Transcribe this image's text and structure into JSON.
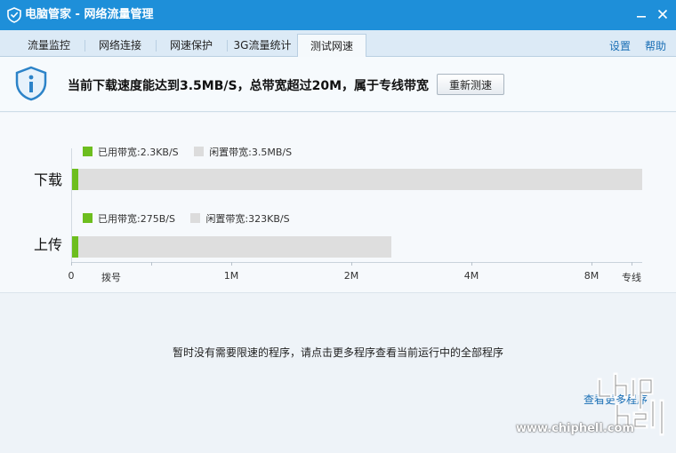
{
  "window": {
    "title": "电脑管家 - 网络流量管理",
    "logo_icon": "shield-logo-icon",
    "minimize_icon": "minimize-icon",
    "close_icon": "close-icon"
  },
  "tabs": [
    {
      "label": "流量监控",
      "active": false
    },
    {
      "label": "网络连接",
      "active": false
    },
    {
      "label": "网速保护",
      "active": false
    },
    {
      "label": "3G流量统计",
      "active": false
    },
    {
      "label": "测试网速",
      "active": true
    }
  ],
  "top_links": {
    "settings": "设置",
    "help": "帮助"
  },
  "banner": {
    "icon": "info-shield-icon",
    "message": "当前下载速度能达到3.5MB/S，总带宽超过20M，属于专线带宽",
    "retest_label": "重新测速"
  },
  "chart_data": {
    "type": "bar",
    "orientation": "horizontal",
    "categories": [
      "下载",
      "上传"
    ],
    "series": [
      {
        "name": "已用带宽",
        "values_text": [
          "2.3KB/S",
          "275B/S"
        ]
      },
      {
        "name": "闲置带宽",
        "values_text": [
          "3.5MB/S",
          "323KB/S"
        ]
      }
    ],
    "legends": {
      "download": {
        "used": "已用带宽:2.3KB/S",
        "idle": "闲置带宽:3.5MB/S"
      },
      "upload": {
        "used": "已用带宽:275B/S",
        "idle": "闲置带宽:323KB/S"
      }
    },
    "bar_fill_fraction": {
      "download": 1.0,
      "upload": 0.56
    },
    "used_fraction": {
      "download": 0.01,
      "upload": 0.01
    },
    "tick_labels": [
      "0",
      "拨号",
      "1M",
      "2M",
      "4M",
      "8M",
      "专线"
    ],
    "colors": {
      "used": "#6dbe1e",
      "idle": "#dcdcdc"
    }
  },
  "notice": "暂时没有需要限速的程序，请点击更多程序查看当前运行中的全部程序",
  "more_link": "查看更多程序",
  "watermark": {
    "url": "www.chiphell.com",
    "logo": "chiphell-logo"
  }
}
